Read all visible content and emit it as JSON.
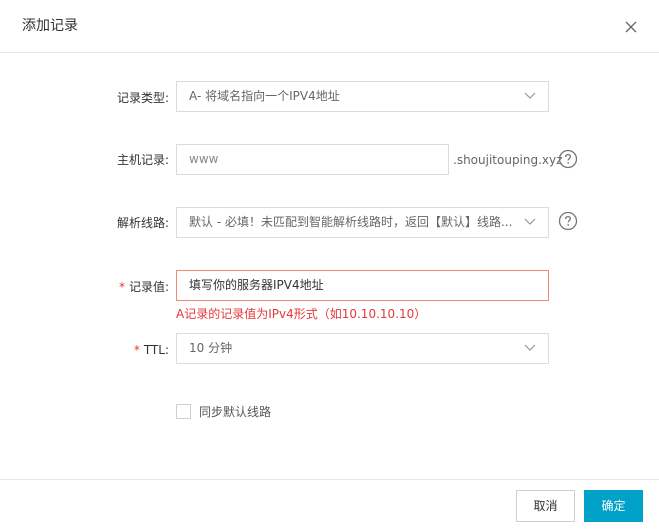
{
  "dialog": {
    "title": "添加记录",
    "close_icon": "close-icon"
  },
  "form": {
    "record_type": {
      "label": "记录类型:",
      "value": "A- 将域名指向一个IPV4地址",
      "icon": "chevron-down-icon"
    },
    "host_record": {
      "label": "主机记录:",
      "value": "www",
      "suffix": ".shoujitouping.xyz",
      "help_icon": "question-circle-icon"
    },
    "line": {
      "label": "解析线路:",
      "value": "默认 - 必填！未匹配到智能解析线路时，返回【默认】线路...",
      "help_icon": "question-circle-icon"
    },
    "record_value": {
      "required_mark": "*",
      "label": "记录值:",
      "value": "填写你的服务器IPV4地址",
      "error": "A记录的记录值为IPv4形式（如10.10.10.10）"
    },
    "ttl": {
      "required_mark": "*",
      "label": "TTL:",
      "value": "10 分钟"
    },
    "sync": {
      "label": "同步默认线路",
      "checked": false
    }
  },
  "footer": {
    "cancel_label": "取消",
    "ok_label": "确定"
  },
  "colors": {
    "accent": "#00a2ca",
    "error": "#e4393c",
    "focus_border": "#f08a72"
  }
}
